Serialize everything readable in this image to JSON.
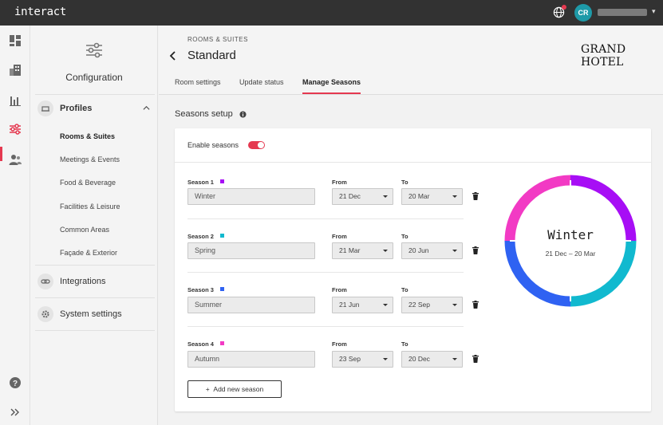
{
  "app": {
    "logo": "interact"
  },
  "topbar": {
    "avatar_initials": "CR",
    "globe_icon": "globe-icon",
    "notification_color": "#e53950"
  },
  "rail": {
    "icons": [
      "dashboard-icon",
      "building-icon",
      "bar-chart-icon",
      "sliders-icon",
      "users-icon",
      "help-icon",
      "expand-icon"
    ],
    "active": "sliders-icon"
  },
  "sidebar": {
    "title": "Configuration",
    "profiles": {
      "label": "Profiles",
      "items": [
        "Rooms & Suites",
        "Meetings & Events",
        "Food & Beverage",
        "Facilities & Leisure",
        "Common Areas",
        "Façade & Exterior"
      ],
      "active_index": 0
    },
    "integrations": "Integrations",
    "system_settings": "System settings"
  },
  "header": {
    "breadcrumb": "ROOMS & SUITES",
    "title": "Standard",
    "brand": "GRAND HOTEL",
    "tabs": [
      "Room settings",
      "Update status",
      "Manage Seasons"
    ],
    "active_tab": 2
  },
  "seasons_setup": {
    "title": "Seasons setup",
    "enable_label": "Enable seasons",
    "enabled": true,
    "from_label": "From",
    "to_label": "To",
    "seasons": [
      {
        "label": "Season 1",
        "name": "Winter",
        "from": "21 Dec",
        "to": "20 Mar",
        "color": "#a70ef5"
      },
      {
        "label": "Season 2",
        "name": "Spring",
        "from": "21 Mar",
        "to": "20 Jun",
        "color": "#11b9cf"
      },
      {
        "label": "Season 3",
        "name": "Summer",
        "from": "21 Jun",
        "to": "22 Sep",
        "color": "#2f62f2"
      },
      {
        "label": "Season 4",
        "name": "Autumn",
        "from": "23 Sep",
        "to": "20 Dec",
        "color": "#f23ac4"
      }
    ],
    "add_button": "Add new season",
    "donut": {
      "name": "Winter",
      "range": "21 Dec – 20 Mar"
    }
  },
  "accent": "#e53950"
}
